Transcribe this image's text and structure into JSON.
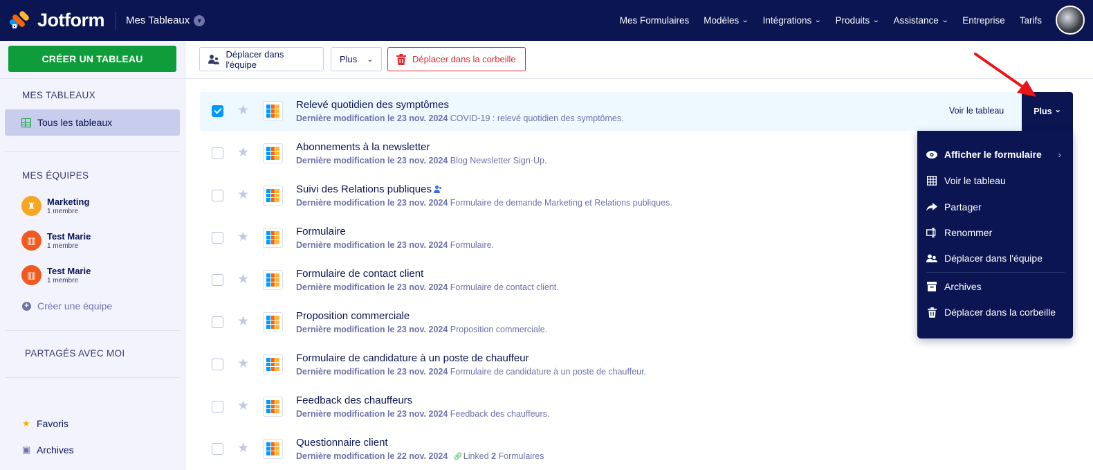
{
  "header": {
    "logo_text": "Jotform",
    "workspace": "Mes Tableaux",
    "nav": [
      {
        "label": "Mes Formulaires",
        "caret": false
      },
      {
        "label": "Modèles",
        "caret": true
      },
      {
        "label": "Intégrations",
        "caret": true
      },
      {
        "label": "Produits",
        "caret": true
      },
      {
        "label": "Assistance",
        "caret": true
      },
      {
        "label": "Entreprise",
        "caret": false
      },
      {
        "label": "Tarifs",
        "caret": false
      }
    ]
  },
  "sidebar": {
    "create_button": "CRÉER UN TABLEAU",
    "my_tables_heading": "MES TABLEAUX",
    "all_tables": "Tous les tableaux",
    "my_teams_heading": "MES ÉQUIPES",
    "teams": [
      {
        "name": "Marketing",
        "members": "1 membre",
        "color": "#f5a623"
      },
      {
        "name": "Test Marie",
        "members": "1 membre",
        "color": "#f05a1e"
      },
      {
        "name": "Test Marie",
        "members": "1 membre",
        "color": "#f05a1e"
      }
    ],
    "create_team": "Créer une équipe",
    "shared_heading": "PARTAGÉS AVEC MOI",
    "favorites": "Favoris",
    "archives": "Archives"
  },
  "toolbar": {
    "move_to_team": "Déplacer dans l'équipe",
    "more": "Plus",
    "move_to_trash": "Déplacer dans la corbeille"
  },
  "tables": [
    {
      "title": "Relevé quotidien des symptômes",
      "modified": "Dernière modification le 23 nov. 2024",
      "desc": "COVID-19 : relevé quotidien des symptômes.",
      "checked": true,
      "shared": false
    },
    {
      "title": "Abonnements à la newsletter",
      "modified": "Dernière modification le 23 nov. 2024",
      "desc": "Blog Newsletter Sign-Up.",
      "checked": false,
      "shared": false
    },
    {
      "title": "Suivi des Relations publiques",
      "modified": "Dernière modification le 23 nov. 2024",
      "desc": "Formulaire de demande Marketing et Relations publiques.",
      "checked": false,
      "shared": true
    },
    {
      "title": "Formulaire",
      "modified": "Dernière modification le 23 nov. 2024",
      "desc": "Formulaire.",
      "checked": false,
      "shared": false
    },
    {
      "title": "Formulaire de contact client",
      "modified": "Dernière modification le 23 nov. 2024",
      "desc": "Formulaire de contact client.",
      "checked": false,
      "shared": false
    },
    {
      "title": "Proposition commerciale",
      "modified": "Dernière modification le 23 nov. 2024",
      "desc": "Proposition commerciale.",
      "checked": false,
      "shared": false
    },
    {
      "title": "Formulaire de candidature à un poste de chauffeur",
      "modified": "Dernière modification le 23 nov. 2024",
      "desc": "Formulaire de candidature à un poste de chauffeur.",
      "checked": false,
      "shared": false
    },
    {
      "title": "Feedback des chauffeurs",
      "modified": "Dernière modification le 23 nov. 2024",
      "desc": "Feedback des chauffeurs.",
      "checked": false,
      "shared": false
    },
    {
      "title": "Questionnaire client",
      "modified": "Dernière modification le 22 nov. 2024",
      "desc": "",
      "linked_prefix": "Linked",
      "linked_count": "2",
      "linked_suffix": "Formulaires",
      "checked": false,
      "shared": false
    }
  ],
  "row_actions": {
    "view_table": "Voir le tableau",
    "more": "Plus"
  },
  "dropdown": {
    "items": [
      {
        "label": "Afficher le formulaire",
        "icon": "eye-icon",
        "bold": true,
        "submenu": true
      },
      {
        "label": "Voir le tableau",
        "icon": "table-icon"
      },
      {
        "label": "Partager",
        "icon": "share-icon"
      },
      {
        "label": "Renommer",
        "icon": "rename-icon"
      },
      {
        "label": "Déplacer dans l'équipe",
        "icon": "team-move-icon"
      },
      {
        "label": "Archives",
        "icon": "archive-icon"
      },
      {
        "label": "Déplacer dans la corbeille",
        "icon": "trash-icon"
      }
    ]
  },
  "colors": {
    "navy": "#0a1551",
    "green": "#0f9c3a",
    "red": "#e0282e",
    "blue": "#0099ff",
    "annotation_arrow": "#e8151b"
  }
}
